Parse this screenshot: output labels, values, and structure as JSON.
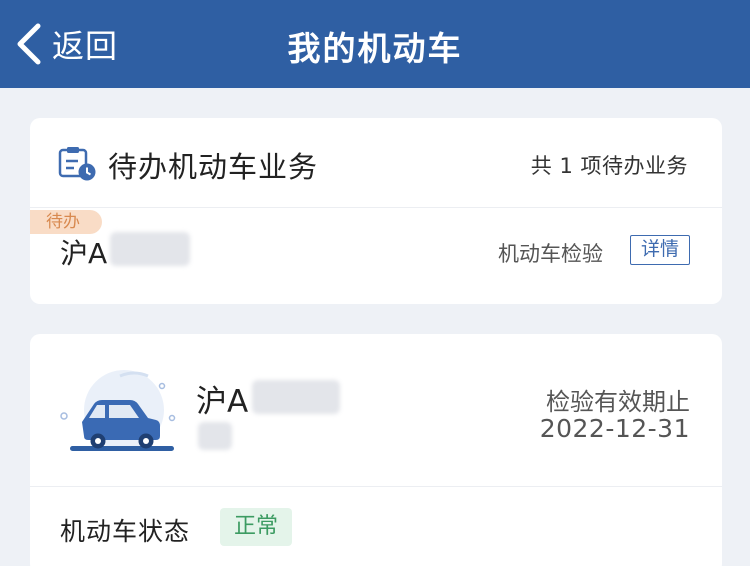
{
  "navbar": {
    "back_label": "返回",
    "title": "我的机动车"
  },
  "pending": {
    "title": "待办机动车业务",
    "count_text": "共 1 项待办业务",
    "tag": "待办",
    "plate_prefix": "沪A",
    "business_type": "机动车检验",
    "detail_label": "详情"
  },
  "vehicle": {
    "plate_prefix": "沪A",
    "expire_label": "检验有效期止",
    "expire_date": "2022-12-31",
    "status_label": "机动车状态",
    "status_value": "正常"
  },
  "colors": {
    "nav_bg": "#2f5fa3",
    "accent": "#3e6bb0",
    "status_green": "#3c9b62",
    "todo_orange": "#d8894f"
  }
}
